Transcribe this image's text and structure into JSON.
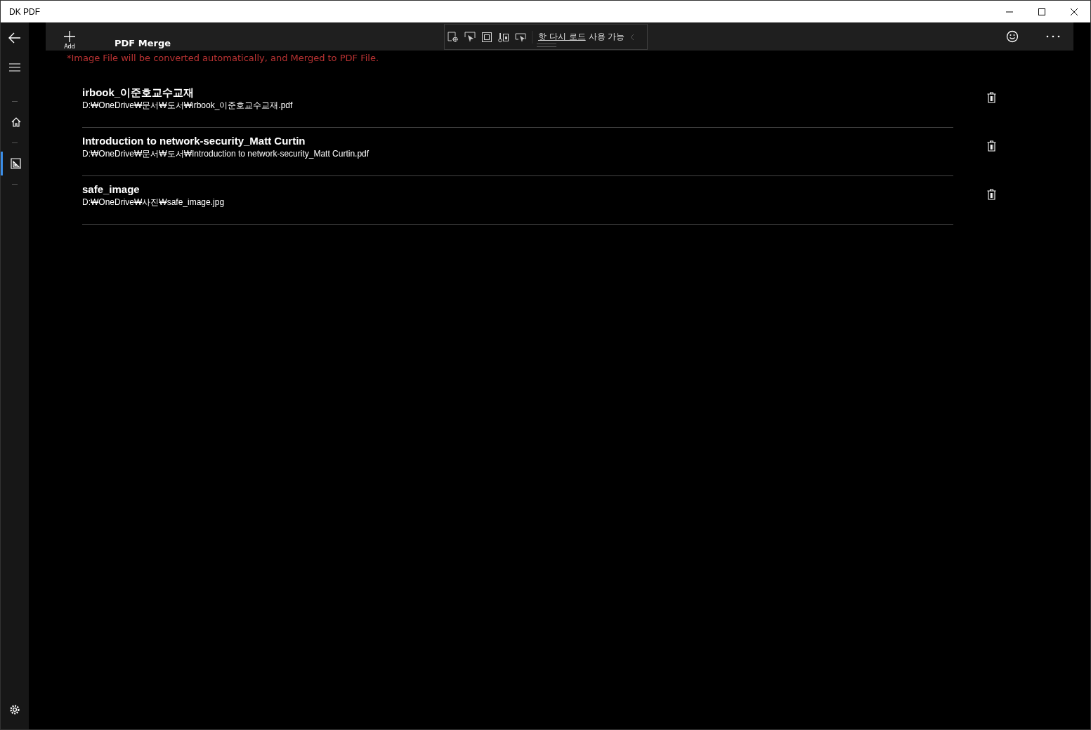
{
  "window": {
    "title": "DK PDF"
  },
  "nav": {
    "items": [
      {
        "kind": "home",
        "selected": false
      },
      {
        "kind": "merge",
        "selected": true
      }
    ]
  },
  "command_bar": {
    "add_label": "Add",
    "title": "PDF Merge"
  },
  "debug_toolbar": {
    "link": "핫 다시 로드",
    "status": "사용 가능"
  },
  "note": "*Image File will be converted automatically, and Merged to PDF File.",
  "files": [
    {
      "name": "irbook_이준호교수교재",
      "path": "D:₩OneDrive₩문서₩도서₩irbook_이준호교수교재.pdf"
    },
    {
      "name": "Introduction to network-security_Matt Curtin",
      "path": "D:₩OneDrive₩문서₩도서₩Introduction to network-security_Matt Curtin.pdf"
    },
    {
      "name": "safe_image",
      "path": "D:₩OneDrive₩사진₩safe_image.jpg"
    }
  ]
}
